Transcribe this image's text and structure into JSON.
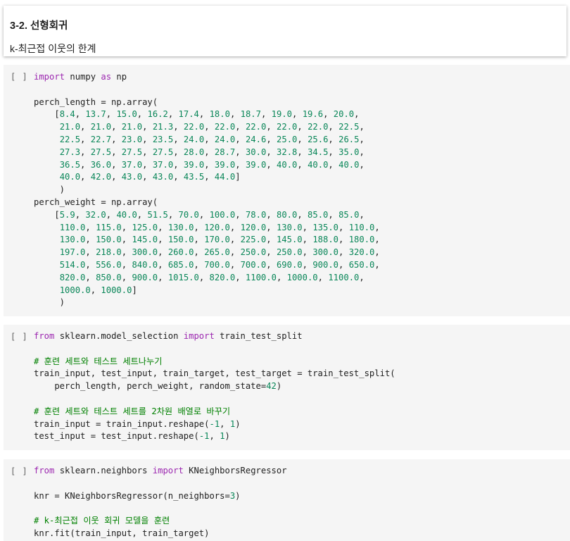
{
  "text_cell": {
    "title": "3-2. 선형회귀",
    "subtitle": "k-최근접 이웃의 한계"
  },
  "code_cells": [
    {
      "run_label": "[ ]",
      "lines": [
        [
          [
            "kw",
            "import"
          ],
          [
            "t",
            " numpy "
          ],
          [
            "kw",
            "as"
          ],
          [
            "t",
            " np"
          ]
        ],
        [],
        [
          [
            "t",
            "perch_length = np.array("
          ]
        ],
        [
          [
            "t",
            "    ["
          ],
          [
            "n",
            "8.4"
          ],
          [
            "t",
            ", "
          ],
          [
            "n",
            "13.7"
          ],
          [
            "t",
            ", "
          ],
          [
            "n",
            "15.0"
          ],
          [
            "t",
            ", "
          ],
          [
            "n",
            "16.2"
          ],
          [
            "t",
            ", "
          ],
          [
            "n",
            "17.4"
          ],
          [
            "t",
            ", "
          ],
          [
            "n",
            "18.0"
          ],
          [
            "t",
            ", "
          ],
          [
            "n",
            "18.7"
          ],
          [
            "t",
            ", "
          ],
          [
            "n",
            "19.0"
          ],
          [
            "t",
            ", "
          ],
          [
            "n",
            "19.6"
          ],
          [
            "t",
            ", "
          ],
          [
            "n",
            "20.0"
          ],
          [
            "t",
            ","
          ]
        ],
        [
          [
            "t",
            "     "
          ],
          [
            "n",
            "21.0"
          ],
          [
            "t",
            ", "
          ],
          [
            "n",
            "21.0"
          ],
          [
            "t",
            ", "
          ],
          [
            "n",
            "21.0"
          ],
          [
            "t",
            ", "
          ],
          [
            "n",
            "21.3"
          ],
          [
            "t",
            ", "
          ],
          [
            "n",
            "22.0"
          ],
          [
            "t",
            ", "
          ],
          [
            "n",
            "22.0"
          ],
          [
            "t",
            ", "
          ],
          [
            "n",
            "22.0"
          ],
          [
            "t",
            ", "
          ],
          [
            "n",
            "22.0"
          ],
          [
            "t",
            ", "
          ],
          [
            "n",
            "22.0"
          ],
          [
            "t",
            ", "
          ],
          [
            "n",
            "22.5"
          ],
          [
            "t",
            ","
          ]
        ],
        [
          [
            "t",
            "     "
          ],
          [
            "n",
            "22.5"
          ],
          [
            "t",
            ", "
          ],
          [
            "n",
            "22.7"
          ],
          [
            "t",
            ", "
          ],
          [
            "n",
            "23.0"
          ],
          [
            "t",
            ", "
          ],
          [
            "n",
            "23.5"
          ],
          [
            "t",
            ", "
          ],
          [
            "n",
            "24.0"
          ],
          [
            "t",
            ", "
          ],
          [
            "n",
            "24.0"
          ],
          [
            "t",
            ", "
          ],
          [
            "n",
            "24.6"
          ],
          [
            "t",
            ", "
          ],
          [
            "n",
            "25.0"
          ],
          [
            "t",
            ", "
          ],
          [
            "n",
            "25.6"
          ],
          [
            "t",
            ", "
          ],
          [
            "n",
            "26.5"
          ],
          [
            "t",
            ","
          ]
        ],
        [
          [
            "t",
            "     "
          ],
          [
            "n",
            "27.3"
          ],
          [
            "t",
            ", "
          ],
          [
            "n",
            "27.5"
          ],
          [
            "t",
            ", "
          ],
          [
            "n",
            "27.5"
          ],
          [
            "t",
            ", "
          ],
          [
            "n",
            "27.5"
          ],
          [
            "t",
            ", "
          ],
          [
            "n",
            "28.0"
          ],
          [
            "t",
            ", "
          ],
          [
            "n",
            "28.7"
          ],
          [
            "t",
            ", "
          ],
          [
            "n",
            "30.0"
          ],
          [
            "t",
            ", "
          ],
          [
            "n",
            "32.8"
          ],
          [
            "t",
            ", "
          ],
          [
            "n",
            "34.5"
          ],
          [
            "t",
            ", "
          ],
          [
            "n",
            "35.0"
          ],
          [
            "t",
            ","
          ]
        ],
        [
          [
            "t",
            "     "
          ],
          [
            "n",
            "36.5"
          ],
          [
            "t",
            ", "
          ],
          [
            "n",
            "36.0"
          ],
          [
            "t",
            ", "
          ],
          [
            "n",
            "37.0"
          ],
          [
            "t",
            ", "
          ],
          [
            "n",
            "37.0"
          ],
          [
            "t",
            ", "
          ],
          [
            "n",
            "39.0"
          ],
          [
            "t",
            ", "
          ],
          [
            "n",
            "39.0"
          ],
          [
            "t",
            ", "
          ],
          [
            "n",
            "39.0"
          ],
          [
            "t",
            ", "
          ],
          [
            "n",
            "40.0"
          ],
          [
            "t",
            ", "
          ],
          [
            "n",
            "40.0"
          ],
          [
            "t",
            ", "
          ],
          [
            "n",
            "40.0"
          ],
          [
            "t",
            ","
          ]
        ],
        [
          [
            "t",
            "     "
          ],
          [
            "n",
            "40.0"
          ],
          [
            "t",
            ", "
          ],
          [
            "n",
            "42.0"
          ],
          [
            "t",
            ", "
          ],
          [
            "n",
            "43.0"
          ],
          [
            "t",
            ", "
          ],
          [
            "n",
            "43.0"
          ],
          [
            "t",
            ", "
          ],
          [
            "n",
            "43.5"
          ],
          [
            "t",
            ", "
          ],
          [
            "n",
            "44.0"
          ],
          [
            "t",
            "]"
          ]
        ],
        [
          [
            "t",
            "     )"
          ]
        ],
        [
          [
            "t",
            "perch_weight = np.array("
          ]
        ],
        [
          [
            "t",
            "    ["
          ],
          [
            "n",
            "5.9"
          ],
          [
            "t",
            ", "
          ],
          [
            "n",
            "32.0"
          ],
          [
            "t",
            ", "
          ],
          [
            "n",
            "40.0"
          ],
          [
            "t",
            ", "
          ],
          [
            "n",
            "51.5"
          ],
          [
            "t",
            ", "
          ],
          [
            "n",
            "70.0"
          ],
          [
            "t",
            ", "
          ],
          [
            "n",
            "100.0"
          ],
          [
            "t",
            ", "
          ],
          [
            "n",
            "78.0"
          ],
          [
            "t",
            ", "
          ],
          [
            "n",
            "80.0"
          ],
          [
            "t",
            ", "
          ],
          [
            "n",
            "85.0"
          ],
          [
            "t",
            ", "
          ],
          [
            "n",
            "85.0"
          ],
          [
            "t",
            ","
          ]
        ],
        [
          [
            "t",
            "     "
          ],
          [
            "n",
            "110.0"
          ],
          [
            "t",
            ", "
          ],
          [
            "n",
            "115.0"
          ],
          [
            "t",
            ", "
          ],
          [
            "n",
            "125.0"
          ],
          [
            "t",
            ", "
          ],
          [
            "n",
            "130.0"
          ],
          [
            "t",
            ", "
          ],
          [
            "n",
            "120.0"
          ],
          [
            "t",
            ", "
          ],
          [
            "n",
            "120.0"
          ],
          [
            "t",
            ", "
          ],
          [
            "n",
            "130.0"
          ],
          [
            "t",
            ", "
          ],
          [
            "n",
            "135.0"
          ],
          [
            "t",
            ", "
          ],
          [
            "n",
            "110.0"
          ],
          [
            "t",
            ","
          ]
        ],
        [
          [
            "t",
            "     "
          ],
          [
            "n",
            "130.0"
          ],
          [
            "t",
            ", "
          ],
          [
            "n",
            "150.0"
          ],
          [
            "t",
            ", "
          ],
          [
            "n",
            "145.0"
          ],
          [
            "t",
            ", "
          ],
          [
            "n",
            "150.0"
          ],
          [
            "t",
            ", "
          ],
          [
            "n",
            "170.0"
          ],
          [
            "t",
            ", "
          ],
          [
            "n",
            "225.0"
          ],
          [
            "t",
            ", "
          ],
          [
            "n",
            "145.0"
          ],
          [
            "t",
            ", "
          ],
          [
            "n",
            "188.0"
          ],
          [
            "t",
            ", "
          ],
          [
            "n",
            "180.0"
          ],
          [
            "t",
            ","
          ]
        ],
        [
          [
            "t",
            "     "
          ],
          [
            "n",
            "197.0"
          ],
          [
            "t",
            ", "
          ],
          [
            "n",
            "218.0"
          ],
          [
            "t",
            ", "
          ],
          [
            "n",
            "300.0"
          ],
          [
            "t",
            ", "
          ],
          [
            "n",
            "260.0"
          ],
          [
            "t",
            ", "
          ],
          [
            "n",
            "265.0"
          ],
          [
            "t",
            ", "
          ],
          [
            "n",
            "250.0"
          ],
          [
            "t",
            ", "
          ],
          [
            "n",
            "250.0"
          ],
          [
            "t",
            ", "
          ],
          [
            "n",
            "300.0"
          ],
          [
            "t",
            ", "
          ],
          [
            "n",
            "320.0"
          ],
          [
            "t",
            ","
          ]
        ],
        [
          [
            "t",
            "     "
          ],
          [
            "n",
            "514.0"
          ],
          [
            "t",
            ", "
          ],
          [
            "n",
            "556.0"
          ],
          [
            "t",
            ", "
          ],
          [
            "n",
            "840.0"
          ],
          [
            "t",
            ", "
          ],
          [
            "n",
            "685.0"
          ],
          [
            "t",
            ", "
          ],
          [
            "n",
            "700.0"
          ],
          [
            "t",
            ", "
          ],
          [
            "n",
            "700.0"
          ],
          [
            "t",
            ", "
          ],
          [
            "n",
            "690.0"
          ],
          [
            "t",
            ", "
          ],
          [
            "n",
            "900.0"
          ],
          [
            "t",
            ", "
          ],
          [
            "n",
            "650.0"
          ],
          [
            "t",
            ","
          ]
        ],
        [
          [
            "t",
            "     "
          ],
          [
            "n",
            "820.0"
          ],
          [
            "t",
            ", "
          ],
          [
            "n",
            "850.0"
          ],
          [
            "t",
            ", "
          ],
          [
            "n",
            "900.0"
          ],
          [
            "t",
            ", "
          ],
          [
            "n",
            "1015.0"
          ],
          [
            "t",
            ", "
          ],
          [
            "n",
            "820.0"
          ],
          [
            "t",
            ", "
          ],
          [
            "n",
            "1100.0"
          ],
          [
            "t",
            ", "
          ],
          [
            "n",
            "1000.0"
          ],
          [
            "t",
            ", "
          ],
          [
            "n",
            "1100.0"
          ],
          [
            "t",
            ","
          ]
        ],
        [
          [
            "t",
            "     "
          ],
          [
            "n",
            "1000.0"
          ],
          [
            "t",
            ", "
          ],
          [
            "n",
            "1000.0"
          ],
          [
            "t",
            "]"
          ]
        ],
        [
          [
            "t",
            "     )"
          ]
        ]
      ]
    },
    {
      "run_label": "[ ]",
      "lines": [
        [
          [
            "kw",
            "from"
          ],
          [
            "t",
            " sklearn.model_selection "
          ],
          [
            "kw",
            "import"
          ],
          [
            "t",
            " train_test_split"
          ]
        ],
        [],
        [
          [
            "c",
            "# 훈련 세트와 테스트 세트나누기"
          ]
        ],
        [
          [
            "t",
            "train_input, test_input, train_target, test_target = train_test_split("
          ]
        ],
        [
          [
            "t",
            "    perch_length, perch_weight, random_state="
          ],
          [
            "n",
            "42"
          ],
          [
            "t",
            ")"
          ]
        ],
        [],
        [
          [
            "c",
            "# 훈련 세트와 테스트 세트를 2차원 배열로 바꾸기"
          ]
        ],
        [
          [
            "t",
            "train_input = train_input.reshape("
          ],
          [
            "n",
            "-1"
          ],
          [
            "t",
            ", "
          ],
          [
            "n",
            "1"
          ],
          [
            "t",
            ")"
          ]
        ],
        [
          [
            "t",
            "test_input = test_input.reshape("
          ],
          [
            "n",
            "-1"
          ],
          [
            "t",
            ", "
          ],
          [
            "n",
            "1"
          ],
          [
            "t",
            ")"
          ]
        ]
      ]
    },
    {
      "run_label": "[ ]",
      "lines": [
        [
          [
            "kw",
            "from"
          ],
          [
            "t",
            " sklearn.neighbors "
          ],
          [
            "kw",
            "import"
          ],
          [
            "t",
            " KNeighborsRegressor"
          ]
        ],
        [],
        [
          [
            "t",
            "knr = KNeighborsRegressor(n_neighbors="
          ],
          [
            "n",
            "3"
          ],
          [
            "t",
            ")"
          ]
        ],
        [],
        [
          [
            "c",
            "# k-최근접 이웃 회귀 모델을 훈련"
          ]
        ],
        [
          [
            "t",
            "knr.fit(train_input, train_target)"
          ]
        ]
      ]
    }
  ],
  "colors": {
    "keyword": "#9c27b0",
    "number": "#098658",
    "comment": "#008000",
    "code_background": "#f5f5f5"
  }
}
